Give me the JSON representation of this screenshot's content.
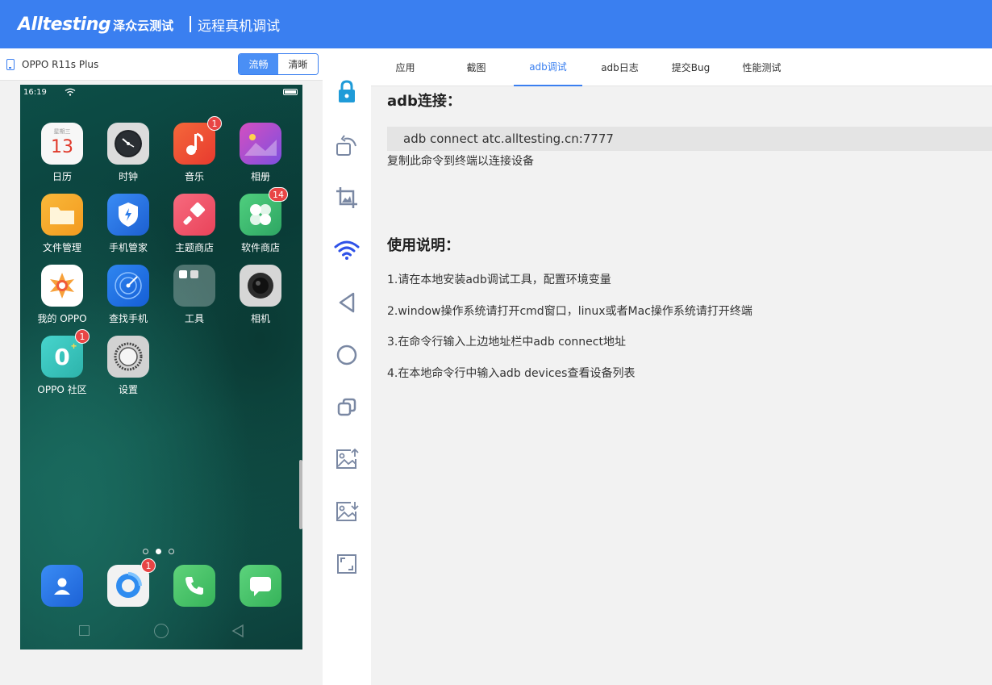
{
  "header": {
    "brand": "Alltesting",
    "brand_cn": "泽众云测试",
    "title": "远程真机调试"
  },
  "device": {
    "name": "OPPO R11s Plus",
    "quality_options": [
      "流畅",
      "清晰"
    ],
    "quality_selected": "流畅"
  },
  "phone": {
    "status_time": "16:19",
    "apps": [
      {
        "label": "日历",
        "icon": "calendar-icon",
        "color": "#f5f5f5",
        "day": "13"
      },
      {
        "label": "时钟",
        "icon": "clock-icon",
        "color": "#d9d9d9"
      },
      {
        "label": "音乐",
        "icon": "music-icon",
        "color": "#ee4a33",
        "badge": "1"
      },
      {
        "label": "相册",
        "icon": "gallery-icon",
        "color": "#b94fd0"
      },
      {
        "label": "文件管理",
        "icon": "folder-icon",
        "color": "#f5a623"
      },
      {
        "label": "手机管家",
        "icon": "shield-icon",
        "color": "#2b7be8"
      },
      {
        "label": "主题商店",
        "icon": "theme-brush-icon",
        "color": "#f0556a"
      },
      {
        "label": "软件商店",
        "icon": "app-store-icon",
        "color": "#34b36f",
        "badge": "14"
      },
      {
        "label": "我的 OPPO",
        "icon": "my-oppo-icon",
        "color": "#ffffff"
      },
      {
        "label": "查找手机",
        "icon": "find-phone-icon",
        "color": "#1e6fe0"
      },
      {
        "label": "工具",
        "icon": "tools-folder-icon",
        "color": "rgba(255,255,255,0.3)"
      },
      {
        "label": "相机",
        "icon": "camera-icon",
        "color": "#d4d4d4"
      },
      {
        "label": "OPPO 社区",
        "icon": "community-icon",
        "color": "#3fc8c0",
        "badge": "1"
      },
      {
        "label": "设置",
        "icon": "settings-icon",
        "color": "#d0d0d0"
      }
    ],
    "dock": [
      {
        "icon": "contacts-icon",
        "color": "#2e7be8"
      },
      {
        "icon": "browser-icon",
        "color": "#f0f0f0",
        "badge": "1"
      },
      {
        "icon": "phone-call-icon",
        "color": "#4cc36a"
      },
      {
        "icon": "messages-icon",
        "color": "#45c06a"
      }
    ]
  },
  "toolbar": [
    "unlock-icon",
    "rotate-icon",
    "screenshot-crop-icon",
    "wifi-icon",
    "back-icon",
    "home-icon",
    "recents-icon",
    "upload-image-icon",
    "download-image-icon",
    "fullscreen-icon"
  ],
  "tabs": [
    "应用",
    "截图",
    "adb调试",
    "adb日志",
    "提交Bug",
    "性能测试"
  ],
  "active_tab": "adb调试",
  "content": {
    "adb_heading": "adb连接：",
    "adb_command": "adb connect atc.alltesting.cn:7777",
    "adb_hint": "复制此命令到终端以连接设备",
    "usage_heading": "使用说明：",
    "steps": [
      "1.请在本地安装adb调试工具，配置环境变量",
      "2.window操作系统请打开cmd窗口，linux或者Mac操作系统请打开终端",
      "3.在命令行输入上边地址栏中adb connect地址",
      "4.在本地命令行中输入adb devices查看设备列表"
    ]
  },
  "colors": {
    "accent": "#3a7ff0",
    "header_bg": "#3a7ff0",
    "badge": "#e84545"
  }
}
